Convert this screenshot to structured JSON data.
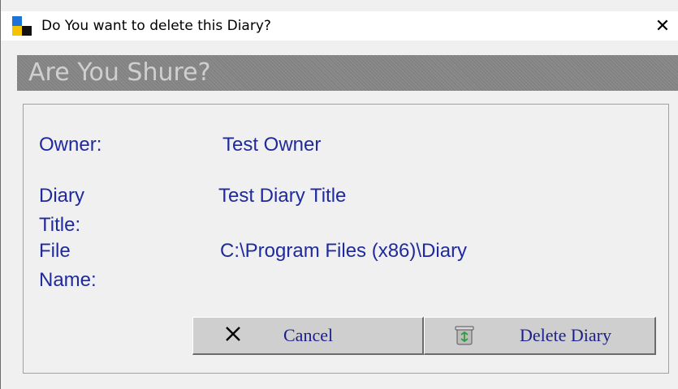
{
  "window": {
    "title": "Do You want to delete this Diary?",
    "close_symbol": "✕"
  },
  "header": {
    "text": "Are You Shure?"
  },
  "details": {
    "owner_label": "Owner:",
    "owner_value": "Test Owner",
    "title_label": "Diary Title:",
    "title_value": "Test Diary Title",
    "file_label": "File Name:",
    "file_value": "C:\\Program Files (x86)\\Diary"
  },
  "buttons": {
    "cancel_label": "Cancel",
    "cancel_icon": "x-icon",
    "delete_label": "Delete Diary",
    "delete_icon": "recycle-bin-icon"
  },
  "colors": {
    "text_blue": "#1f2a9c",
    "header_gray": "#848484",
    "header_text": "#cfcfcf",
    "button_face": "#cfcfcf"
  }
}
